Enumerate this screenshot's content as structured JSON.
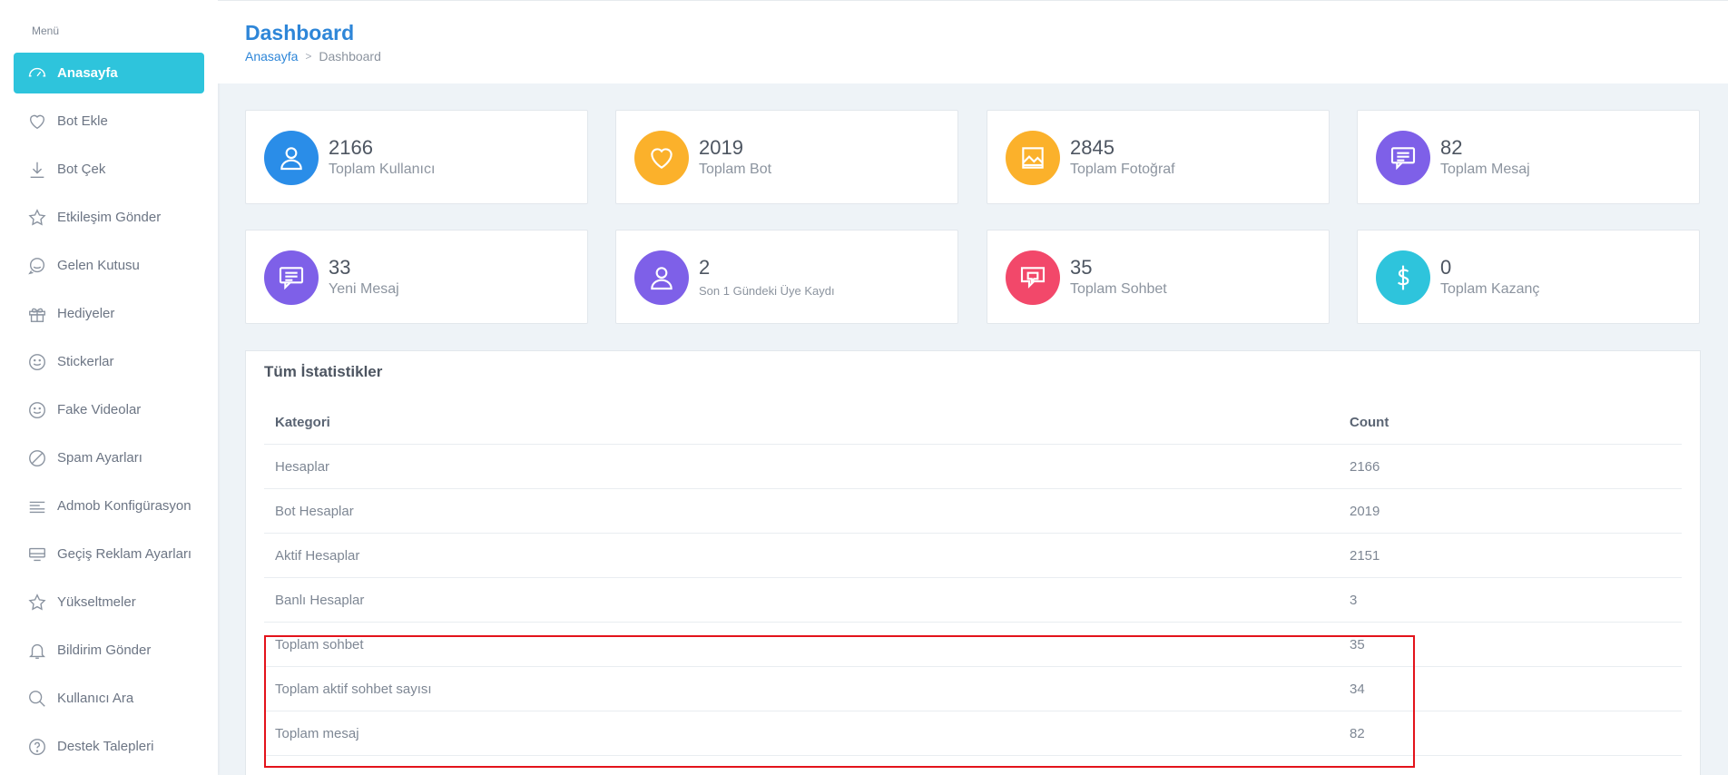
{
  "sidebar": {
    "title": "Menü",
    "items": [
      {
        "label": "Anasayfa",
        "icon": "dashboard-icon"
      },
      {
        "label": "Bot Ekle",
        "icon": "heart-icon"
      },
      {
        "label": "Bot Çek",
        "icon": "download-icon"
      },
      {
        "label": "Etkileşim Gönder",
        "icon": "star-icon"
      },
      {
        "label": "Gelen Kutusu",
        "icon": "chat-icon"
      },
      {
        "label": "Hediyeler",
        "icon": "gift-icon"
      },
      {
        "label": "Stickerlar",
        "icon": "smile-icon"
      },
      {
        "label": "Fake Videolar",
        "icon": "smile-icon"
      },
      {
        "label": "Spam Ayarları",
        "icon": "block-icon"
      },
      {
        "label": "Admob Konfigürasyon",
        "icon": "lines-icon"
      },
      {
        "label": "Geçiş Reklam Ayarları",
        "icon": "monitor-icon"
      },
      {
        "label": "Yükseltmeler",
        "icon": "star-icon"
      },
      {
        "label": "Bildirim Gönder",
        "icon": "bell-icon"
      },
      {
        "label": "Kullanıcı Ara",
        "icon": "search-icon"
      },
      {
        "label": "Destek Talepleri",
        "icon": "help-icon"
      }
    ]
  },
  "header": {
    "title": "Dashboard",
    "breadcrumb": {
      "home": "Anasayfa",
      "separator": ">",
      "current": "Dashboard"
    }
  },
  "cards": [
    {
      "value": "2166",
      "label": "Toplam Kullanıcı",
      "color": "#2a8de8",
      "icon": "user-icon"
    },
    {
      "value": "2019",
      "label": "Toplam Bot",
      "color": "#fbb12b",
      "icon": "heart-icon"
    },
    {
      "value": "2845",
      "label": "Toplam Fotoğraf",
      "color": "#fbb12b",
      "icon": "image-icon"
    },
    {
      "value": "82",
      "label": "Toplam Mesaj",
      "color": "#7e60e8",
      "icon": "message-icon"
    },
    {
      "value": "33",
      "label": "Yeni Mesaj",
      "color": "#7e60e8",
      "icon": "message-icon"
    },
    {
      "value": "2",
      "label": "Son 1 Gündeki Üye Kaydı",
      "color": "#7e60e8",
      "icon": "user-icon"
    },
    {
      "value": "35",
      "label": "Toplam Sohbet",
      "color": "#f2486a",
      "icon": "chat-icon"
    },
    {
      "value": "0",
      "label": "Toplam Kazanç",
      "color": "#2ec4dc",
      "icon": "dollar-icon"
    }
  ],
  "stats": {
    "title": "Tüm İstatistikler",
    "columns": [
      "Kategori",
      "Count"
    ],
    "rows": [
      [
        "Hesaplar",
        "2166"
      ],
      [
        "Bot Hesaplar",
        "2019"
      ],
      [
        "Aktif Hesaplar",
        "2151"
      ],
      [
        "Banlı Hesaplar",
        "3"
      ],
      [
        "Toplam sohbet",
        "35"
      ],
      [
        "Toplam aktif sohbet sayısı",
        "34"
      ],
      [
        "Toplam mesaj",
        "82"
      ]
    ]
  },
  "colors": {
    "accent": "#2ec4dc",
    "link": "#2e86d8",
    "highlight": "#e3131b"
  }
}
